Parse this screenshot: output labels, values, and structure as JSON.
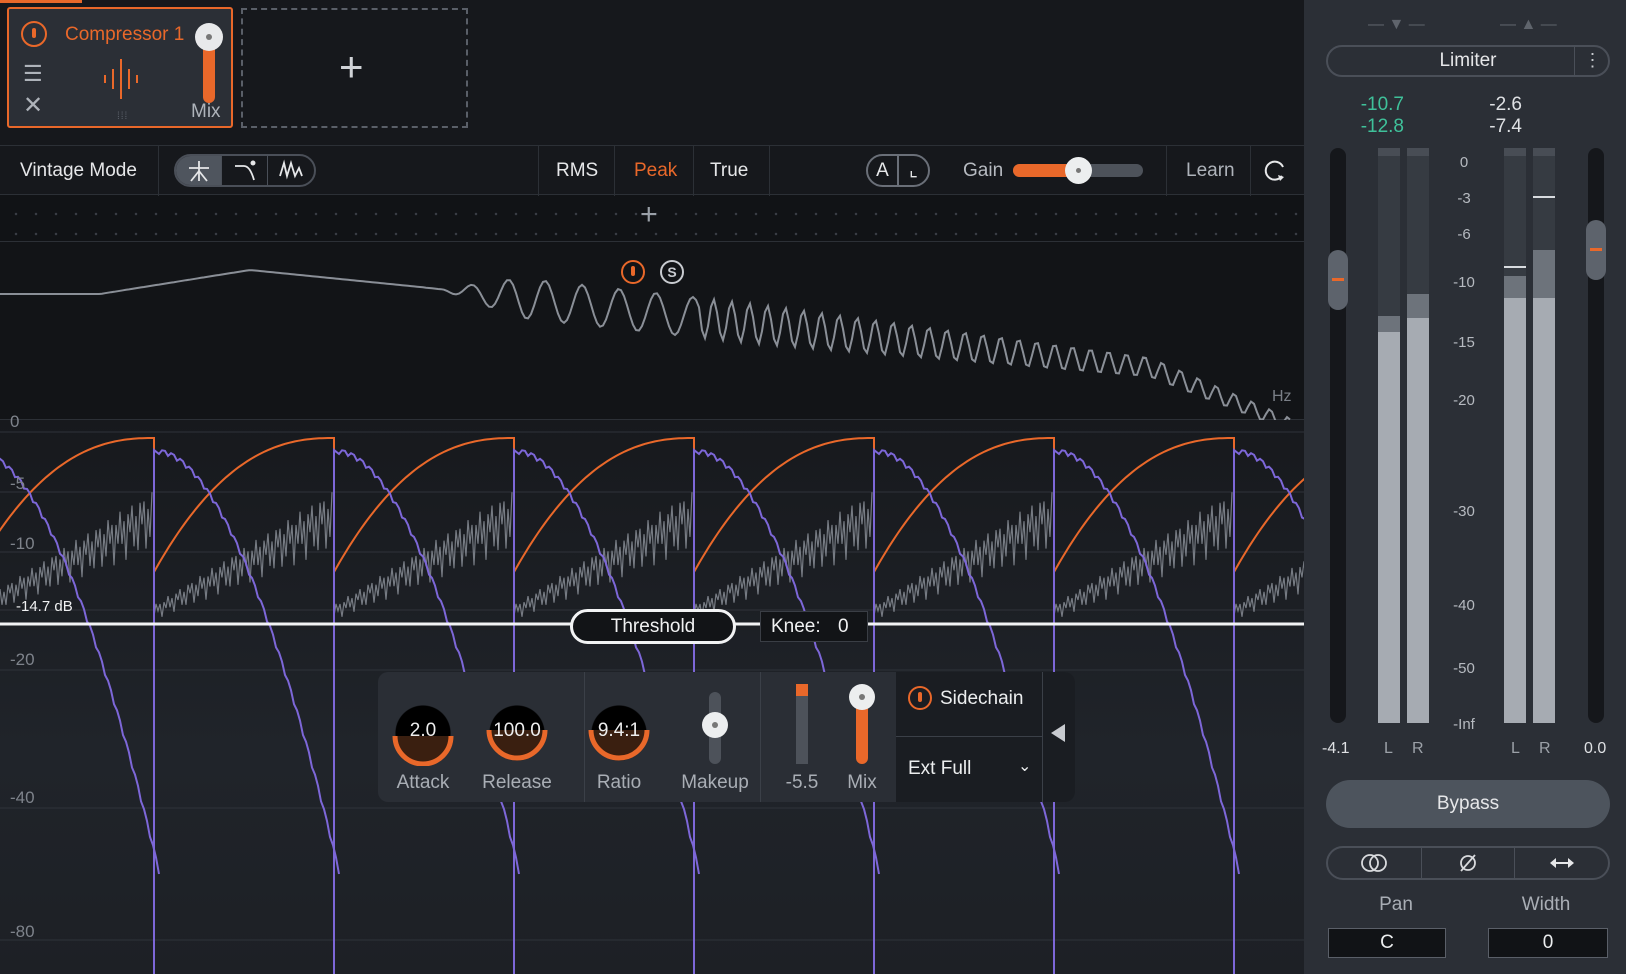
{
  "module": {
    "title": "Compressor 1",
    "mix_label": "Mix",
    "mix_value": 1.0,
    "add_label": "+"
  },
  "toolbar": {
    "vintage_mode": "Vintage Mode",
    "mode_buttons": [
      "digital-mode",
      "analog-mode",
      "vintage-mode"
    ],
    "detection": {
      "rms": "RMS",
      "peak": "Peak",
      "true": "True",
      "selected": "Peak"
    },
    "ab": {
      "a": "A",
      "b": "⌞"
    },
    "gain_label": "Gain",
    "gain_value": 0.5,
    "learn": "Learn"
  },
  "spectrum": {
    "hz_label": "Hz",
    "solo_label": "S"
  },
  "graph": {
    "y_labels": [
      "0",
      "-5",
      "-10",
      "-20",
      "-40",
      "-80"
    ],
    "threshold_readout": "-14.7 dB",
    "threshold_label": "Threshold",
    "knee_label": "Knee:",
    "knee_value": "0"
  },
  "controls": {
    "attack": {
      "value": "2.0",
      "label": "Attack"
    },
    "release": {
      "value": "100.0",
      "label": "Release"
    },
    "ratio": {
      "value": "9.4:1",
      "label": "Ratio"
    },
    "makeup": {
      "label": "Makeup",
      "value": 0.5
    },
    "gain_reduction": {
      "value": "-5.5",
      "fill": 0.15
    },
    "mix": {
      "label": "Mix",
      "value": 1.0
    },
    "sidechain": {
      "label": "Sidechain",
      "source": "Ext Full"
    }
  },
  "meters": {
    "mode_button": "Limiter",
    "menu_icon": "⋮",
    "input_peaks": [
      "-10.7",
      "-12.8"
    ],
    "output_peaks": [
      "-2.6",
      "-7.4"
    ],
    "scale": [
      "0",
      "-3",
      "-6",
      "-10",
      "-15",
      "-20",
      "-30",
      "-40",
      "-50",
      "-Inf"
    ],
    "input_gain": "-4.1",
    "output_gain": "0.0",
    "channels": [
      "L",
      "R"
    ],
    "bypass": "Bypass",
    "pan_label": "Pan",
    "pan_value": "C",
    "width_label": "Width",
    "width_value": "0"
  },
  "colors": {
    "accent": "#e9682a",
    "envelope": "#7d67d8",
    "input_peak": "#3fc19a"
  }
}
